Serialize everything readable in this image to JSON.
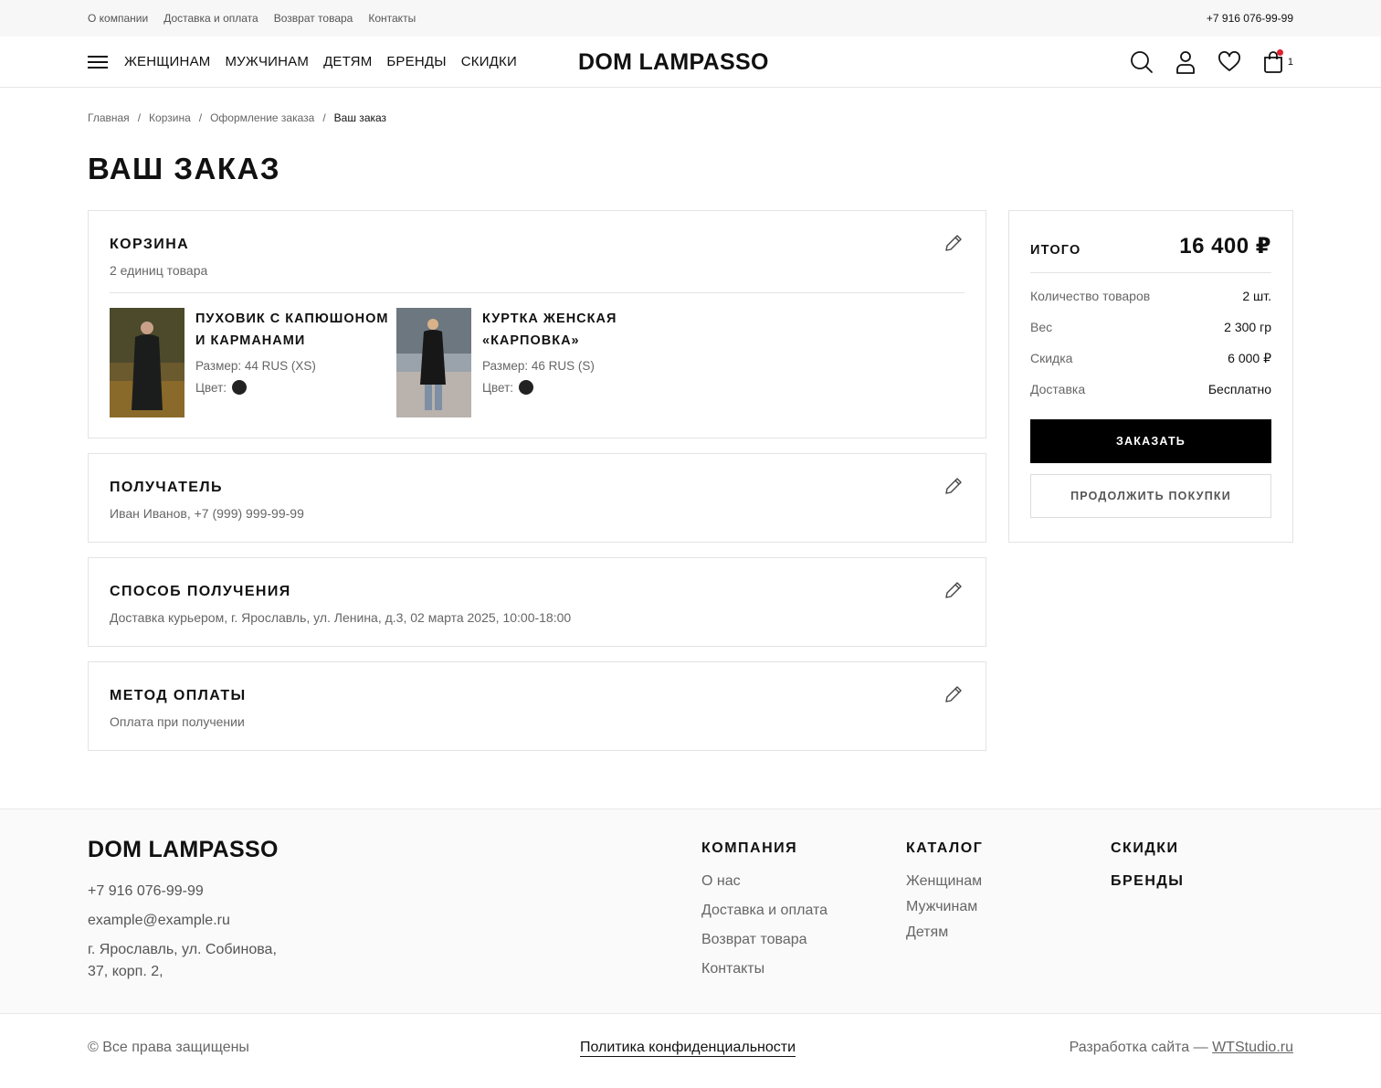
{
  "topbar": {
    "links": [
      "О компании",
      "Доставка и оплата",
      "Возврат товара",
      "Контакты"
    ],
    "phone": "+7 916 076-99-99"
  },
  "header": {
    "nav": [
      "ЖЕНЩИНАМ",
      "МУЖЧИНАМ",
      "ДЕТЯМ",
      "БРЕНДЫ",
      "СКИДКИ"
    ],
    "logo": "DOM LAMPASSO",
    "cart_count": "1",
    "icons": [
      "menu-icon",
      "search-icon",
      "user-icon",
      "heart-icon",
      "cart-icon"
    ]
  },
  "breadcrumbs": [
    "Главная",
    "Корзина",
    "Оформление заказа",
    "Ваш заказ"
  ],
  "breadcrumb_sep": "/",
  "page_title": "ВАШ ЗАКАЗ",
  "cart": {
    "title": "КОРЗИНА",
    "subtitle": "2 единиц товара",
    "items": [
      {
        "title_line1": "ПУХОВИК С КАПЮШОНОМ",
        "title_line2": "И КАРМАНАМИ",
        "size": "Размер: 44 RUS (XS)",
        "color_label": "Цвет:",
        "color": "#222222"
      },
      {
        "title_line1": "КУРТКА ЖЕНСКАЯ",
        "title_line2": "«КАРПОВКА»",
        "size": "Размер: 46 RUS (S)",
        "color_label": "Цвет:",
        "color": "#222222"
      }
    ]
  },
  "recipient": {
    "title": "ПОЛУЧАТЕЛЬ",
    "value": "Иван Иванов, +7 (999) 999-99-99"
  },
  "delivery": {
    "title": "СПОСОБ ПОЛУЧЕНИЯ",
    "value": "Доставка курьером, г. Ярославль, ул. Ленина, д.3, 02 марта 2025, 10:00-18:00"
  },
  "payment": {
    "title": "МЕТОД ОПЛАТЫ",
    "value": "Оплата при получении"
  },
  "summary": {
    "label": "ИТОГО",
    "total": "16 400 ₽",
    "rows": [
      {
        "k": "Количество товаров",
        "v": "2 шт."
      },
      {
        "k": "Вес",
        "v": "2 300 гр"
      },
      {
        "k": "Скидка",
        "v": "6 000 ₽"
      },
      {
        "k": "Доставка",
        "v": "Бесплатно"
      }
    ],
    "order_button": "ЗАКАЗАТЬ",
    "continue_button": "ПРОДОЛЖИТЬ ПОКУПКИ"
  },
  "footer": {
    "logo": "DOM LAMPASSO",
    "phone": "+7 916 076-99-99",
    "email": "example@example.ru",
    "address_line1": "г. Ярославль, ул. Собинова,",
    "address_line2": "37, корп. 2,",
    "company": {
      "title": "КОМПАНИЯ",
      "links": [
        "О нас",
        "Доставка и оплата",
        "Возврат товара",
        "Контакты"
      ]
    },
    "catalog": {
      "title": "КАТАЛОГ",
      "links": [
        "Женщинам",
        "Мужчинам",
        "Детям"
      ]
    },
    "discounts": "СКИДКИ",
    "brands": "БРЕНДЫ",
    "copyright": "© Все права защищены",
    "policy": "Политика конфиденциальности",
    "dev_prefix": "Разработка сайта —",
    "dev_link": "WTStudio.ru"
  }
}
